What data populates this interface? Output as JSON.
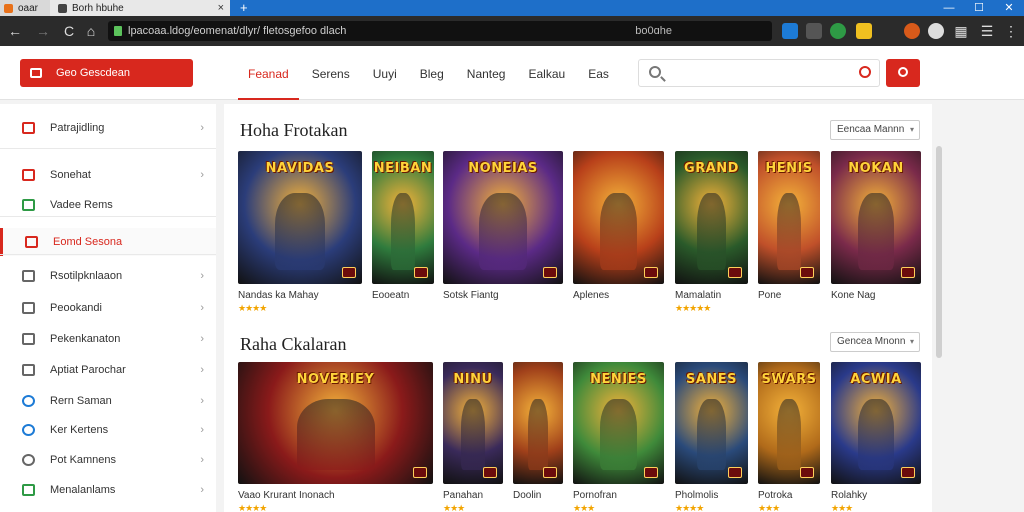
{
  "browser": {
    "tab1_label": "oaar",
    "tab2_label": "Borh hbuhe",
    "tab_close": "×",
    "new_tab": "+",
    "win_min": "—",
    "win_max": "☐",
    "win_close": "✕",
    "back": "←",
    "forward": "→",
    "reload": "C",
    "home": "⌂",
    "url": "lpacoaa.ldog/eomenat/dlyr/ fletosgefoo dlach",
    "url_right": "bo0ɑhe",
    "menu": "⋮"
  },
  "topbar": {
    "cta_label": "Geo Gescdean",
    "tabs": [
      {
        "label": "Feanad"
      },
      {
        "label": "Serens"
      },
      {
        "label": "Uuyi"
      },
      {
        "label": "Bleg"
      },
      {
        "label": "Nanteg"
      },
      {
        "label": "Ealkau"
      },
      {
        "label": "Eas"
      }
    ],
    "search_placeholder": ""
  },
  "sidebar": {
    "items": [
      {
        "label": "Patrajidling",
        "icon": "gift-icon",
        "color": "#d8281e"
      },
      {
        "label": "Sonehat",
        "icon": "bag-icon",
        "color": "#d8281e"
      },
      {
        "label": "Vadee Rems",
        "icon": "chart-icon",
        "color": "#2e9a45"
      },
      {
        "label": "Eomd Sesona",
        "icon": "gamepad-icon",
        "color": "#d8281e"
      },
      {
        "label": "Rsotilpknlaaon",
        "icon": "grid-icon",
        "color": "#666666"
      },
      {
        "label": "Peookandi",
        "icon": "folder-icon",
        "color": "#666666"
      },
      {
        "label": "Pekenkanaton",
        "icon": "list-icon",
        "color": "#666666"
      },
      {
        "label": "Aptiat Parochar",
        "icon": "doc-icon",
        "color": "#666666"
      },
      {
        "label": "Rern Saman",
        "icon": "globe-icon",
        "color": "#1d7bd6"
      },
      {
        "label": "Ker Kertens",
        "icon": "circle-icon",
        "color": "#1d7bd6"
      },
      {
        "label": "Pot Kamnens",
        "icon": "settings-icon",
        "color": "#666666"
      },
      {
        "label": "Menalanlams",
        "icon": "check-icon",
        "color": "#2e9a45"
      }
    ]
  },
  "section1": {
    "title": "Hoha Frotakan",
    "sort_label": "Eencaa Mannn",
    "games": [
      {
        "cover_text": "NAVIDAS",
        "name": "Nandas ka Mahay",
        "stars": "★★★★",
        "color": "#2b3d7a"
      },
      {
        "cover_text": "NEIBAN",
        "name": "Eooeatn",
        "stars": "",
        "color": "#2f7b3d"
      },
      {
        "cover_text": "NONEIAS",
        "name": "Sotsk Fiantg",
        "stars": "",
        "color": "#5b2a86"
      },
      {
        "cover_text": "",
        "name": "Aplenes",
        "stars": "",
        "color": "#b8401a"
      },
      {
        "cover_text": "GRAND",
        "name": "Mamalatin",
        "stars": "★★★★★",
        "color": "#2a5a2a"
      },
      {
        "cover_text": "HENIS",
        "name": "Pone",
        "stars": "",
        "color": "#c0502a"
      },
      {
        "cover_text": "NOKAN",
        "name": "Kone Nag",
        "stars": "",
        "color": "#7a2a4a"
      }
    ]
  },
  "section2": {
    "title": "Raha Ckalaran",
    "sort_label": "Gencea Mnonn",
    "games": [
      {
        "cover_text": "NOVERIEY",
        "name": "Vaao Krurant Inonach",
        "stars": "★★★★",
        "color": "#8a1a1a"
      },
      {
        "cover_text": "NINU",
        "name": "Panahan",
        "stars": "★★★",
        "color": "#3a2a5a"
      },
      {
        "cover_text": "",
        "name": "Doolin",
        "stars": "",
        "color": "#a0401a"
      },
      {
        "cover_text": "NENIES",
        "name": "Pornofran",
        "stars": "★★★",
        "color": "#3f8a3a"
      },
      {
        "cover_text": "SANES",
        "name": "Pholmolis",
        "stars": "★★★★",
        "color": "#2a4a7a"
      },
      {
        "cover_text": "SWARS",
        "name": "Potroka",
        "stars": "★★★",
        "color": "#b06a1a"
      },
      {
        "cover_text": "ACWIA",
        "name": "Rolahky",
        "stars": "★★★",
        "color": "#2a3a8a"
      }
    ]
  }
}
